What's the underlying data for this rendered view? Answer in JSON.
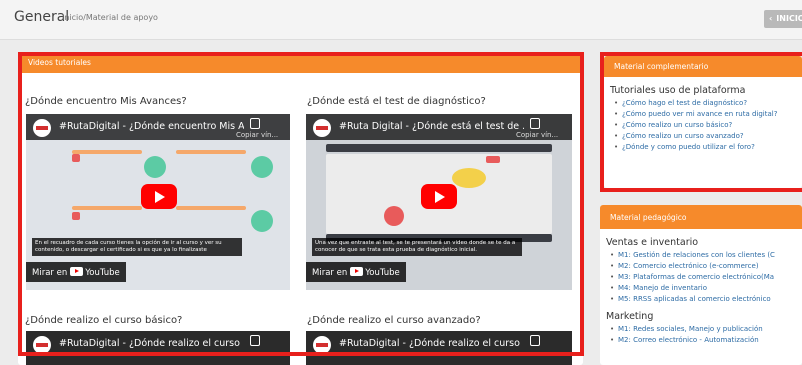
{
  "header": {
    "title": "General",
    "breadcrumb": "Inicio/Material de apoyo",
    "back_label": "INICIO"
  },
  "main": {
    "panel_title": "Videos tutoriales",
    "videos": [
      {
        "heading": "¿Dónde encuentro Mis Avances?",
        "player_title": "#RutaDigital - ¿Dónde encuentro Mis A...",
        "copy_label": "Copiar vín...",
        "caption": "En el recuadro de cada curso tienes la opción de ir al curso y ver su contenido, o descargar el certificado si es que ya lo finalizaste",
        "watch_label": "Mirar en",
        "watch_brand": "YouTube"
      },
      {
        "heading": "¿Dónde está el test de diagnóstico?",
        "player_title": "#Ruta Digital - ¿Dónde está el test de ...",
        "copy_label": "Copiar vín...",
        "caption": "Una vez que entraste al test, se te presentará un video donde se te da a conocer de que se trata esta prueba de diagnóstico inicial.",
        "watch_label": "Mirar en",
        "watch_brand": "YouTube"
      },
      {
        "heading": "¿Dónde realizo el curso básico?",
        "player_title": "#RutaDigital - ¿Dónde realizo el curso ..."
      },
      {
        "heading": "¿Dónde realizo el curso avanzado?",
        "player_title": "#RutaDigital - ¿Dónde realizo el curso ..."
      }
    ]
  },
  "sidebar": {
    "complementario": {
      "panel_title": "Material complementario",
      "section": "Tutoriales uso de plataforma",
      "links": [
        "¿Cómo hago el test de diagnóstico?",
        "¿Cómo puedo ver mi avance en ruta digital?",
        "¿Cómo realizo un curso básico?",
        "¿Cómo realizo un curso avanzado?",
        "¿Dónde y como puedo utilizar el foro?"
      ]
    },
    "pedagogico": {
      "panel_title": "Material pedagógico",
      "sections": [
        {
          "title": "Ventas e inventario",
          "links": [
            "M1: Gestión de relaciones con los clientes (C",
            "M2: Comercio electrónico (e-commerce)",
            "M3: Plataformas de comercio electrónico(Ma",
            "M4: Manejo de inventario",
            "M5: RRSS aplicadas al comercio electrónico"
          ]
        },
        {
          "title": "Marketing",
          "links": [
            "M1: Redes sociales, Manejo y publicación",
            "M2: Correo electrónico - Automatización"
          ]
        }
      ]
    }
  },
  "colors": {
    "accent": "#f68a2b",
    "highlight_frame": "#e8201c",
    "link": "#2e6ca5"
  }
}
